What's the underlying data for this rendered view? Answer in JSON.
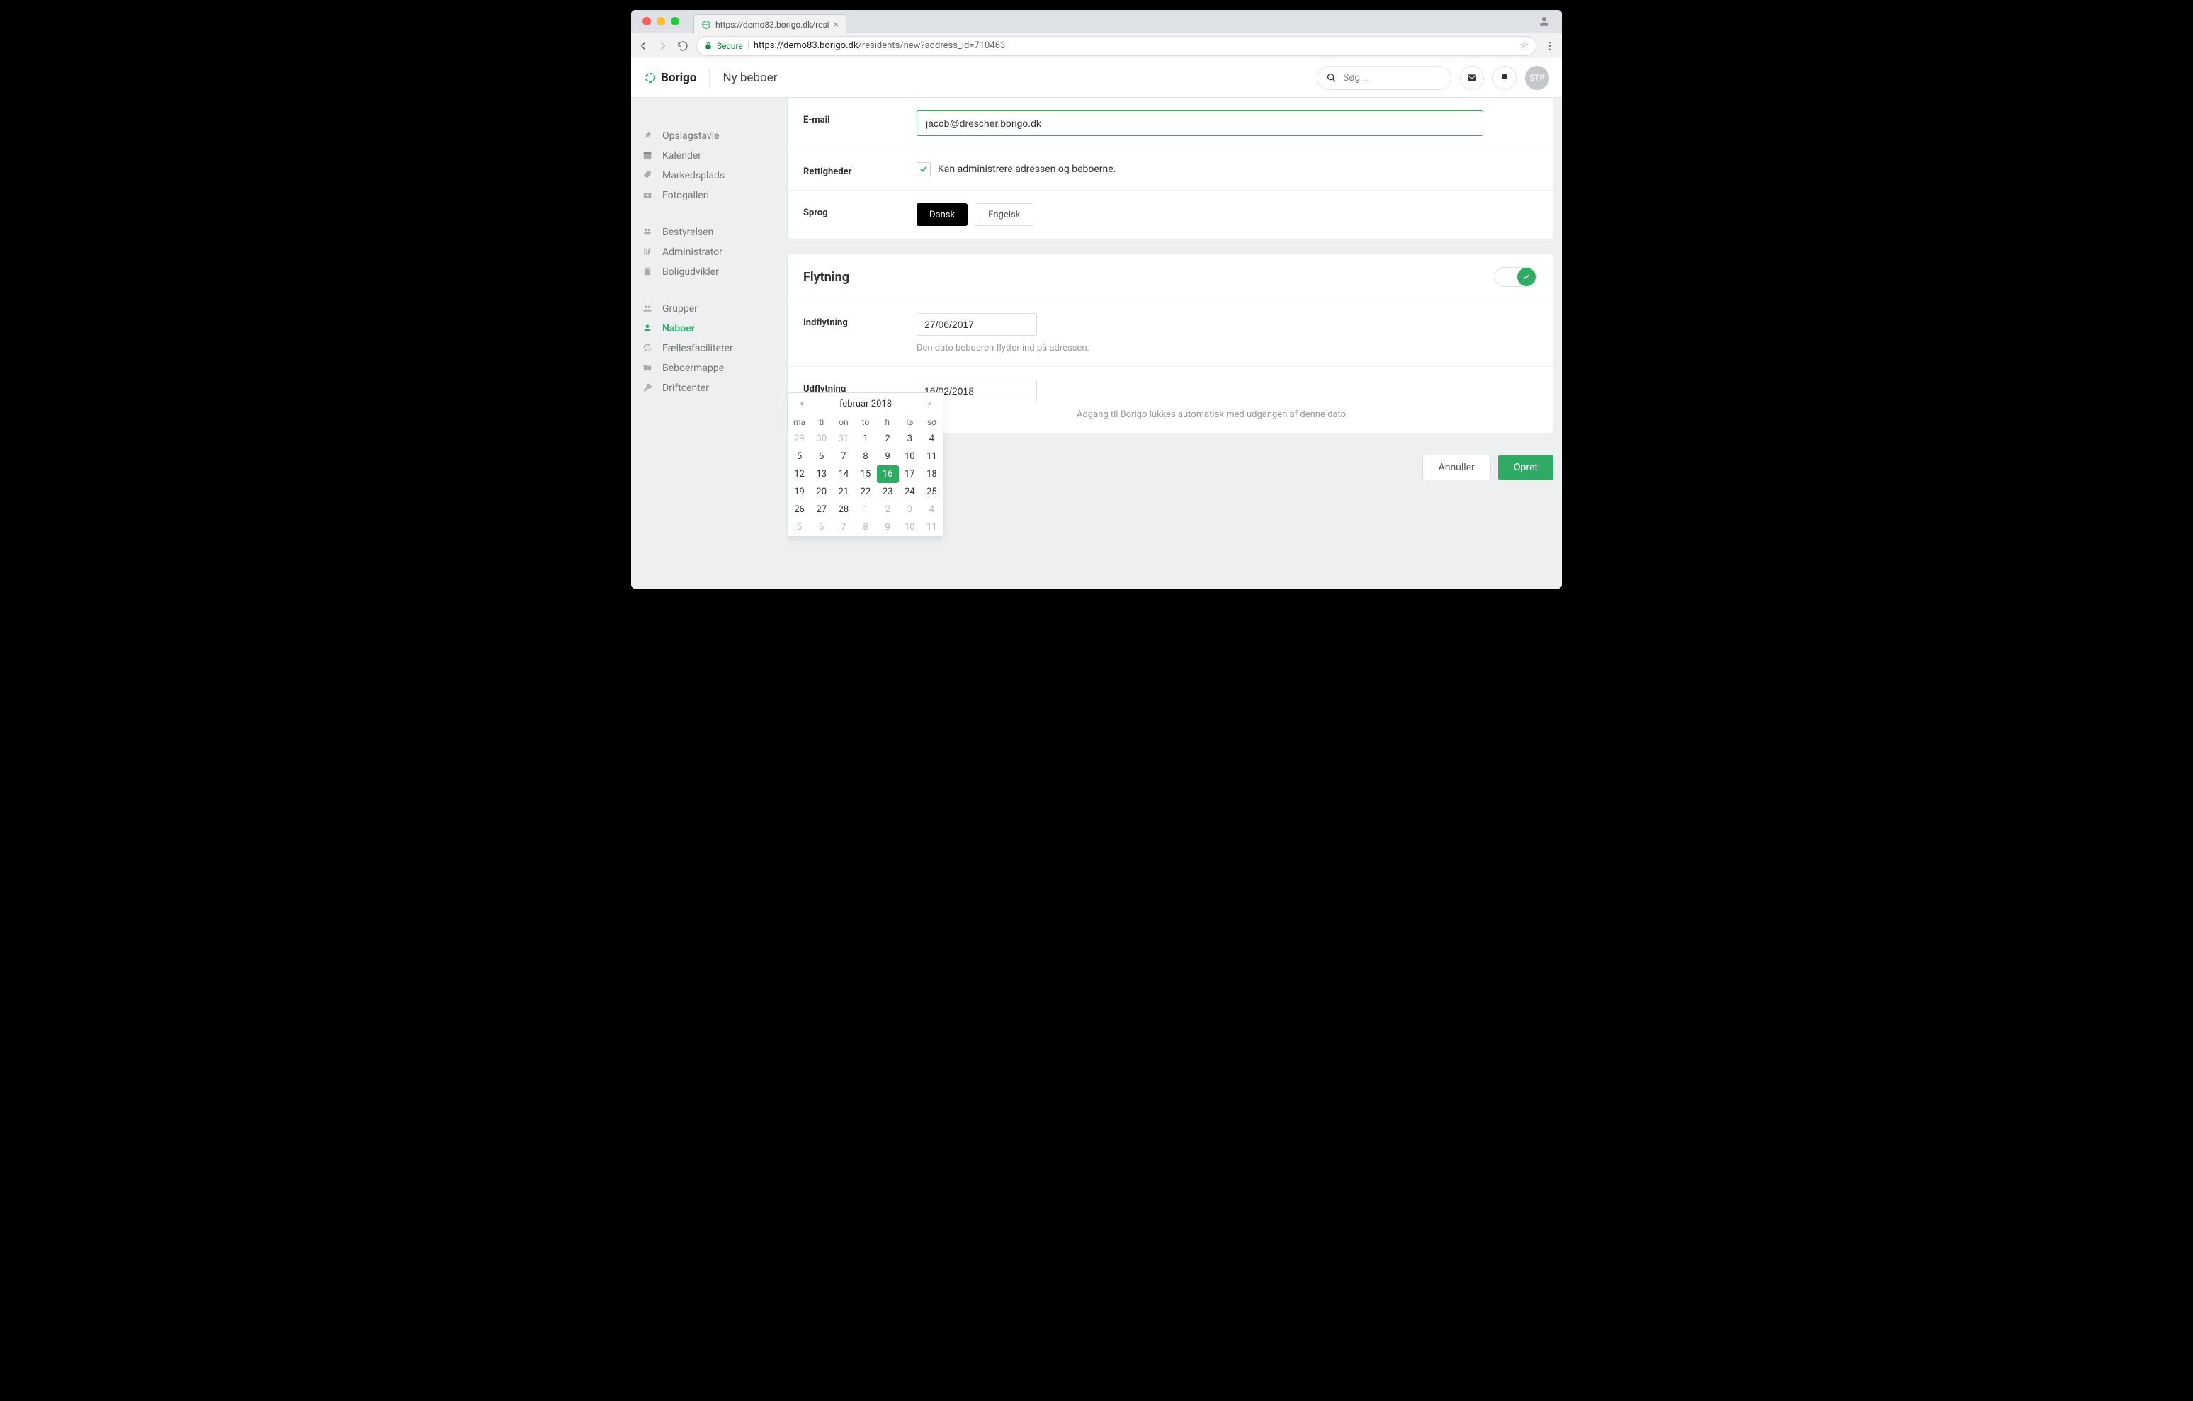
{
  "browser": {
    "tab_title": "https://demo83.borigo.dk/resi",
    "url_secure_label": "Secure",
    "url_host": "https://demo83.borigo.dk",
    "url_path": "/residents/new?address_id=710463"
  },
  "header": {
    "brand": "Borigo",
    "page_title": "Ny beboer",
    "search_placeholder": "Søg …",
    "avatar_initials": "STP"
  },
  "sidebar": {
    "group1": [
      {
        "label": "Opslagstavle",
        "icon": "pin-icon"
      },
      {
        "label": "Kalender",
        "icon": "calendar-icon"
      },
      {
        "label": "Markedsplads",
        "icon": "tag-icon"
      },
      {
        "label": "Fotogalleri",
        "icon": "camera-icon"
      }
    ],
    "group2": [
      {
        "label": "Bestyrelsen",
        "icon": "board-icon"
      },
      {
        "label": "Administrator",
        "icon": "library-icon"
      },
      {
        "label": "Boligudvikler",
        "icon": "building-icon"
      }
    ],
    "group3": [
      {
        "label": "Grupper",
        "icon": "group-icon"
      },
      {
        "label": "Naboer",
        "icon": "person-icon",
        "active": true
      },
      {
        "label": "Fællesfaciliteter",
        "icon": "sync-icon"
      },
      {
        "label": "Beboermappe",
        "icon": "folder-icon"
      },
      {
        "label": "Driftcenter",
        "icon": "wrench-icon"
      }
    ]
  },
  "form": {
    "email_label": "E-mail",
    "email_value": "jacob@drescher.borigo.dk",
    "rights_label": "Rettigheder",
    "rights_checkbox_label": "Kan administrere adressen og beboerne.",
    "language_label": "Sprog",
    "language_options": [
      "Dansk",
      "Engelsk"
    ]
  },
  "moving": {
    "section_title": "Flytning",
    "move_in_label": "Indflytning",
    "move_in_value": "27/06/2017",
    "move_in_helper": "Den dato beboeren flytter ind på adressen.",
    "move_out_label": "Udflytning",
    "move_out_value": "16/02/2018",
    "move_out_helper": "Adgang til Borigo lukkes automatisk med udgangen af denne dato."
  },
  "datepicker": {
    "title": "februar 2018",
    "dow": [
      "ma",
      "ti",
      "on",
      "to",
      "fr",
      "lø",
      "sø"
    ],
    "weeks": [
      [
        {
          "d": "29",
          "m": true
        },
        {
          "d": "30",
          "m": true
        },
        {
          "d": "31",
          "m": true
        },
        {
          "d": "1"
        },
        {
          "d": "2"
        },
        {
          "d": "3"
        },
        {
          "d": "4"
        }
      ],
      [
        {
          "d": "5"
        },
        {
          "d": "6"
        },
        {
          "d": "7"
        },
        {
          "d": "8"
        },
        {
          "d": "9"
        },
        {
          "d": "10"
        },
        {
          "d": "11"
        }
      ],
      [
        {
          "d": "12"
        },
        {
          "d": "13"
        },
        {
          "d": "14"
        },
        {
          "d": "15"
        },
        {
          "d": "16",
          "sel": true
        },
        {
          "d": "17"
        },
        {
          "d": "18"
        }
      ],
      [
        {
          "d": "19"
        },
        {
          "d": "20"
        },
        {
          "d": "21"
        },
        {
          "d": "22"
        },
        {
          "d": "23"
        },
        {
          "d": "24"
        },
        {
          "d": "25"
        }
      ],
      [
        {
          "d": "26"
        },
        {
          "d": "27"
        },
        {
          "d": "28"
        },
        {
          "d": "1",
          "m": true
        },
        {
          "d": "2",
          "m": true
        },
        {
          "d": "3",
          "m": true
        },
        {
          "d": "4",
          "m": true
        }
      ],
      [
        {
          "d": "5",
          "m": true
        },
        {
          "d": "6",
          "m": true
        },
        {
          "d": "7",
          "m": true
        },
        {
          "d": "8",
          "m": true
        },
        {
          "d": "9",
          "m": true
        },
        {
          "d": "10",
          "m": true
        },
        {
          "d": "11",
          "m": true
        }
      ]
    ]
  },
  "actions": {
    "cancel": "Annuller",
    "create": "Opret"
  }
}
